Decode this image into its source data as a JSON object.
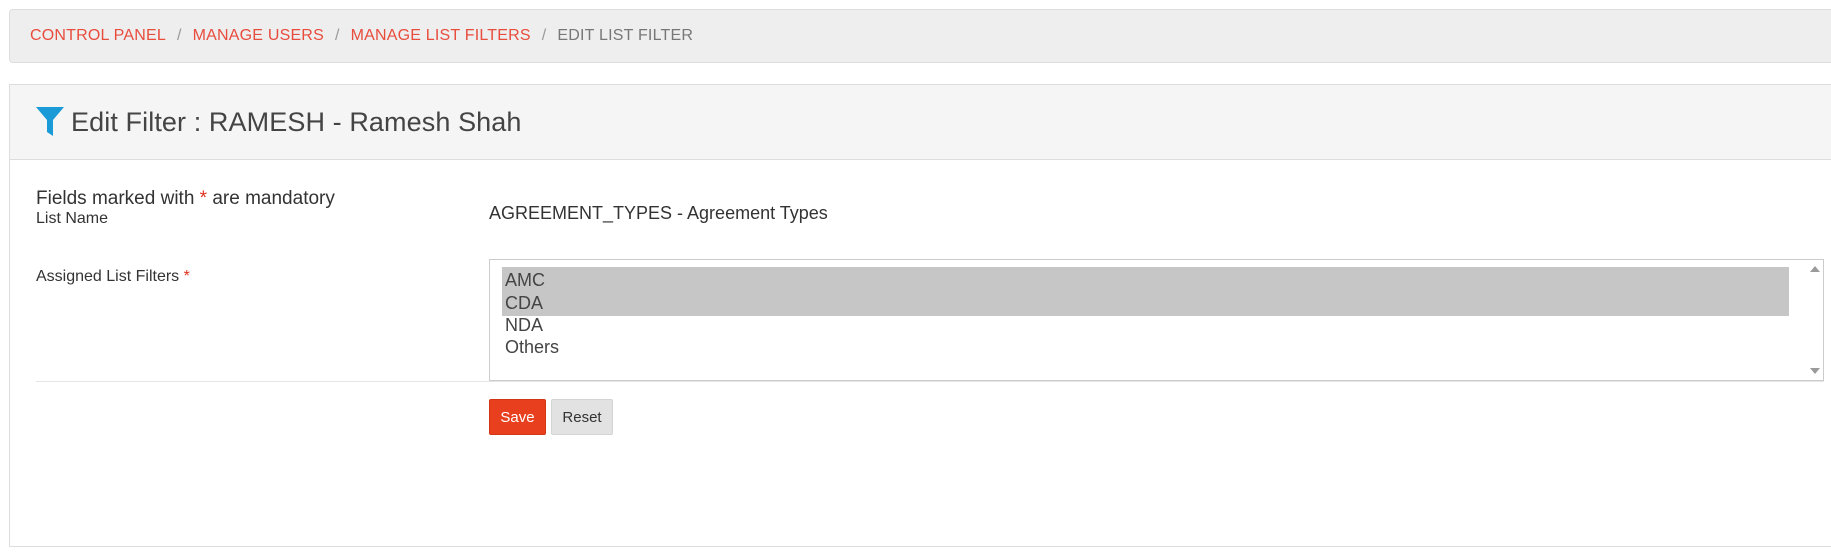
{
  "breadcrumb": {
    "items": [
      "CONTROL PANEL",
      "MANAGE USERS",
      "MANAGE LIST FILTERS"
    ],
    "current": "EDIT LIST FILTER",
    "separator": "/"
  },
  "panel": {
    "icon": "filter-icon",
    "title": "Edit Filter : RAMESH - Ramesh Shah"
  },
  "form": {
    "mandatory_prefix": "Fields marked with",
    "mandatory_star": "*",
    "mandatory_suffix": "are mandatory",
    "list_name_label": "List Name",
    "list_name_value": "AGREEMENT_TYPES - Agreement Types",
    "assigned_label": "Assigned List Filters",
    "assigned_star": "*",
    "options": [
      {
        "label": "AMC",
        "selected": true
      },
      {
        "label": "CDA",
        "selected": true
      },
      {
        "label": "NDA",
        "selected": false
      },
      {
        "label": "Others",
        "selected": false
      }
    ]
  },
  "actions": {
    "save_label": "Save",
    "reset_label": "Reset"
  },
  "colors": {
    "accent": "#e84c3d",
    "save_button": "#e8401f",
    "icon": "#1a9ad6",
    "selected_option": "#c6c6c6"
  }
}
